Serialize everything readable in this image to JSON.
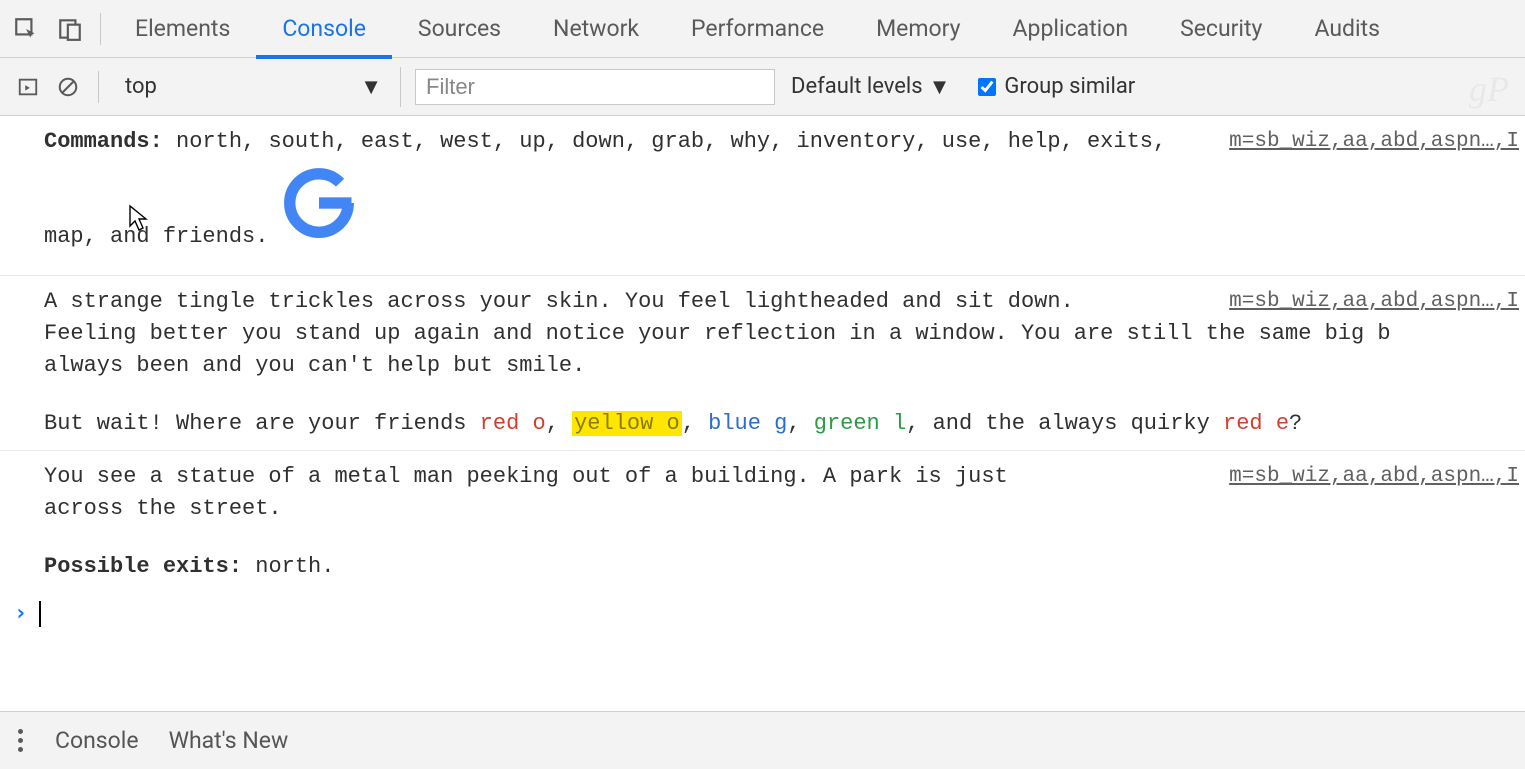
{
  "tabs": {
    "items": [
      "Elements",
      "Console",
      "Sources",
      "Network",
      "Performance",
      "Memory",
      "Application",
      "Security",
      "Audits"
    ],
    "active": "Console"
  },
  "toolbar": {
    "context": "top",
    "filter_placeholder": "Filter",
    "levels_label": "Default levels",
    "group_similar_label": "Group similar",
    "group_similar_checked": true
  },
  "watermark": "gP",
  "console": {
    "source_link": "m=sb_wiz,aa,abd,aspn…,I",
    "block1": {
      "commands_label": "Commands:",
      "commands_list": " north, south, east, west, up, down, grab, why, inventory, use, help, exits, map, and friends."
    },
    "block2": {
      "line1": "A strange tingle trickles across your skin.  You feel lightheaded and sit down.",
      "line2": "Feeling better you stand up again and notice your reflection in a window.  You are still the same big b",
      "line3": "always been and you can't help but smile.",
      "friends_pre": "But wait!  Where are your friends ",
      "f_red_o": "red o",
      "f_yellow_o": "yellow o",
      "f_blue_g": "blue g",
      "f_green_l": "green l",
      "friends_mid": ", and the always quirky ",
      "f_red_e": "red e",
      "q": "?"
    },
    "block3": {
      "line1": "You see a statue of a metal man peeking out of a building.  A park is just",
      "line2": "across the street.",
      "exits_label": "Possible exits:",
      "exits_val": " north."
    }
  },
  "drawer": {
    "tabs": [
      "Console",
      "What's New"
    ]
  }
}
